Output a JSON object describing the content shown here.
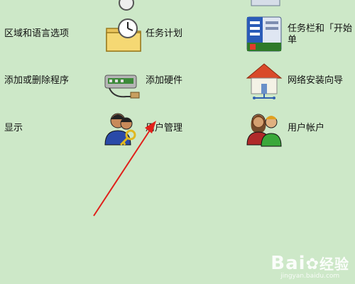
{
  "items": {
    "region_language": "区域和语言选项",
    "scheduled_tasks": "任务计划",
    "taskbar_start_line1": "任务栏和「开始",
    "taskbar_start_line2": "单",
    "add_remove_programs": "添加或删除程序",
    "add_hardware": "添加硬件",
    "network_wizard": "网络安装向导",
    "display": "显示",
    "user_management": "用户管理",
    "user_accounts": "用户帐户"
  },
  "watermark": {
    "brand": "Bai",
    "brand2": "经验",
    "url": "jingyan.baidu.com"
  },
  "colors": {
    "background": "#cde8c8",
    "annotation_arrow": "#e0201a"
  }
}
